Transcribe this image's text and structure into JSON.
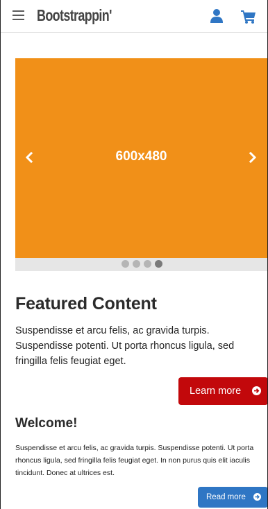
{
  "header": {
    "brand": "Bootstrappin'",
    "menu_icon": "hamburger-menu-icon",
    "user_icon": "user-icon",
    "cart_icon": "shopping-cart-icon",
    "icon_color": "#2f76c4"
  },
  "carousel": {
    "slide_label": "600x480",
    "slide_color": "#f19018",
    "prev_icon": "chevron-left-icon",
    "next_icon": "chevron-right-icon",
    "slide_count": 4,
    "active_index": 3
  },
  "featured": {
    "title": "Featured Content",
    "body": "Suspendisse et arcu felis, ac gravida turpis. Suspendisse potenti. Ut porta rhoncus ligula, sed fringilla felis feugiat eget.",
    "button_label": "Learn more",
    "button_icon": "circle-arrow-right-icon",
    "button_color": "#c2080b"
  },
  "welcome": {
    "title": "Welcome!",
    "body": "Suspendisse et arcu felis, ac gravida turpis. Suspendisse potenti. Ut porta rhoncus ligula, sed fringilla felis feugiat eget. In non purus quis elit iaculis tincidunt. Donec at ultrices est.",
    "button_label": "Read more",
    "button_icon": "circle-arrow-right-icon",
    "button_color": "#2f76c4"
  }
}
